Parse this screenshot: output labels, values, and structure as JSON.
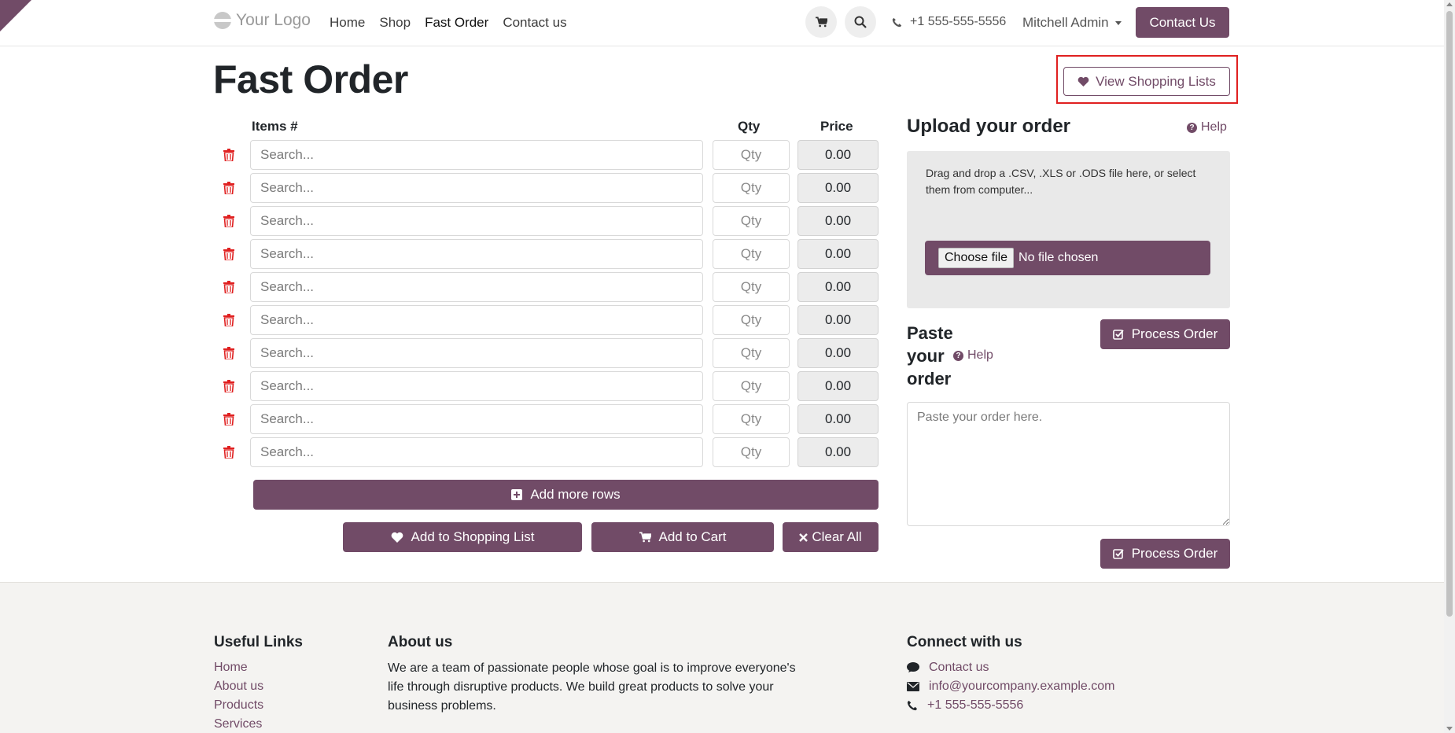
{
  "header": {
    "logo": "Your Logo",
    "nav": [
      "Home",
      "Shop",
      "Fast Order",
      "Contact us"
    ],
    "active_nav": "Fast Order",
    "phone": "+1 555-555-5556",
    "user": "Mitchell Admin",
    "contact_button": "Contact Us"
  },
  "page": {
    "title": "Fast Order",
    "view_lists_button": "View Shopping Lists"
  },
  "table": {
    "col_items": "Items #",
    "col_qty": "Qty",
    "col_price": "Price",
    "rows": [
      {
        "search_placeholder": "Search...",
        "qty_placeholder": "Qty",
        "price": "0.00"
      },
      {
        "search_placeholder": "Search...",
        "qty_placeholder": "Qty",
        "price": "0.00"
      },
      {
        "search_placeholder": "Search...",
        "qty_placeholder": "Qty",
        "price": "0.00"
      },
      {
        "search_placeholder": "Search...",
        "qty_placeholder": "Qty",
        "price": "0.00"
      },
      {
        "search_placeholder": "Search...",
        "qty_placeholder": "Qty",
        "price": "0.00"
      },
      {
        "search_placeholder": "Search...",
        "qty_placeholder": "Qty",
        "price": "0.00"
      },
      {
        "search_placeholder": "Search...",
        "qty_placeholder": "Qty",
        "price": "0.00"
      },
      {
        "search_placeholder": "Search...",
        "qty_placeholder": "Qty",
        "price": "0.00"
      },
      {
        "search_placeholder": "Search...",
        "qty_placeholder": "Qty",
        "price": "0.00"
      },
      {
        "search_placeholder": "Search...",
        "qty_placeholder": "Qty",
        "price": "0.00"
      }
    ],
    "add_rows_button": "Add more rows",
    "add_to_list_button": "Add to Shopping List",
    "add_to_cart_button": "Add to Cart",
    "clear_all_button": "Clear All"
  },
  "upload": {
    "title": "Upload your order",
    "help": "Help",
    "drop_text": "Drag and drop a .CSV, .XLS or .ODS file here, or select them from computer...",
    "choose_file": "Choose file",
    "no_file": "No file chosen"
  },
  "paste": {
    "title": "Paste your order",
    "help": "Help",
    "process_button": "Process Order",
    "placeholder": "Paste your order here.",
    "process_button_bottom": "Process Order"
  },
  "footer": {
    "useful_links_title": "Useful Links",
    "useful_links": [
      "Home",
      "About us",
      "Products",
      "Services"
    ],
    "about_title": "About us",
    "about_text": "We are a team of passionate people whose goal is to improve everyone's life through disruptive products. We build great products to solve your business problems.",
    "connect_title": "Connect with us",
    "connect": {
      "contact": "Contact us",
      "email": "info@yourcompany.example.com",
      "phone": "+1 555-555-5556"
    }
  },
  "colors": {
    "brand": "#714B67",
    "danger": "#e02020",
    "footer_bg": "#f4f3f1"
  },
  "icons": {
    "cart": "cart-icon",
    "search": "search-icon",
    "phone": "phone-icon",
    "heart": "heart-icon",
    "trash": "trash-icon",
    "plus": "plus-square-icon",
    "close": "times-icon",
    "help": "question-circle-icon",
    "edit": "check-square-icon",
    "comment": "comment-icon",
    "envelope": "envelope-icon"
  }
}
